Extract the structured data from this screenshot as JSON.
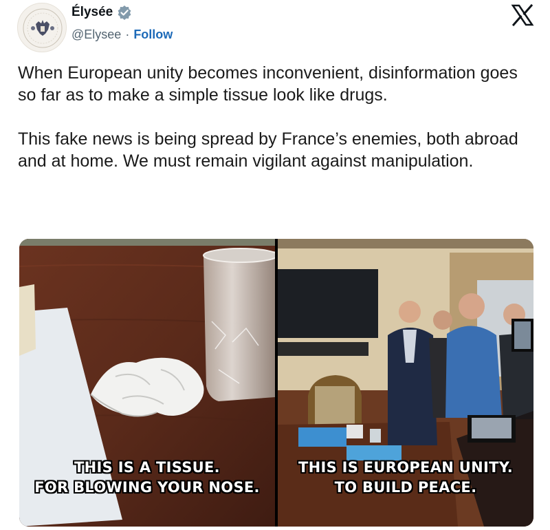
{
  "header": {
    "display_name": "Élysée",
    "handle": "@Elysee",
    "separator": "·",
    "follow_label": "Follow",
    "verified_color": "#829aab",
    "follow_color": "#1d6ab8"
  },
  "post": {
    "paragraphs": [
      "When European unity becomes inconvenient, disinformation goes so far as to make a simple tissue look like drugs.",
      "This fake news is being spread by France’s enemies, both abroad and at home. We must remain vigilant against manipulation."
    ]
  },
  "media": {
    "left_caption": [
      "THIS IS A TISSUE.",
      "FOR BLOWING YOUR NOSE."
    ],
    "right_caption": [
      "THIS IS EUROPEAN UNITY.",
      "TO BUILD PEACE."
    ]
  },
  "icons": {
    "avatar": "presidency-seal-icon",
    "verified": "verified-badge-icon",
    "platform": "x-logo-icon"
  }
}
